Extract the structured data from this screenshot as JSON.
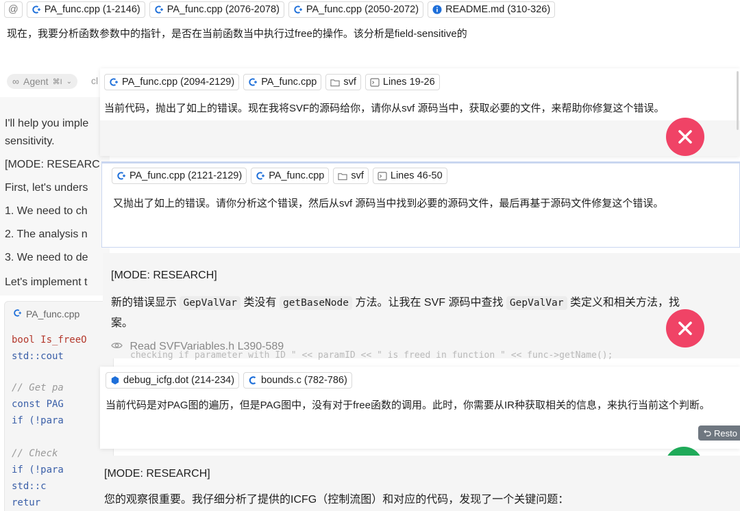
{
  "top_bar": {
    "at_symbol": "@",
    "chips": [
      {
        "label": "PA_func.cpp (1-2146)",
        "icon": "cpp-file-icon"
      },
      {
        "label": "PA_func.cpp (2076-2078)",
        "icon": "cpp-file-icon"
      },
      {
        "label": "PA_func.cpp (2050-2072)",
        "icon": "cpp-file-icon"
      },
      {
        "label": "README.md (310-326)",
        "icon": "info-icon"
      }
    ],
    "prompt": "现在，我要分析函数参数中的指针，是否在当前函数当中执行过free的操作。该分析是field-sensitive的"
  },
  "background": {
    "agent_label": "Agent",
    "agent_shortcut": "⌘I",
    "agent_extra": "cl",
    "lines": [
      "I'll help you imple",
      "sensitivity.",
      "[MODE: RESEARC",
      "First, let's unders",
      "1. We need to ch",
      "2. The analysis n",
      "3. We need to de",
      "Let's implement t"
    ],
    "code_file": "PA_func.cpp",
    "code_lines": [
      {
        "text": "bool Is_freeO",
        "kind": "decl"
      },
      {
        "text": "    std::cout",
        "kind": "plain"
      },
      {
        "text": "    // Get pa",
        "kind": "comment"
      },
      {
        "text": "    const PAG",
        "kind": "keyword"
      },
      {
        "text": "    if (!para",
        "kind": "keyword"
      },
      {
        "text": "    // Check ",
        "kind": "comment"
      },
      {
        "text": "    if (!para",
        "kind": "keyword"
      },
      {
        "text": "        std::c",
        "kind": "plain"
      },
      {
        "text": "        retur",
        "kind": "plain"
      }
    ]
  },
  "card1": {
    "chips": [
      {
        "label": "PA_func.cpp (2094-2129)",
        "icon": "cpp-file-icon"
      },
      {
        "label": "PA_func.cpp",
        "icon": "cpp-file-icon"
      },
      {
        "label": "svf",
        "icon": "folder-icon"
      },
      {
        "label": "Lines 19-26",
        "icon": "terminal-icon"
      }
    ],
    "text": "当前代码，抛出了如上的错误。现在我将SVF的源码给你，请你从svf 源码当中，获取必要的文件，来帮助你修复这个错误。"
  },
  "card2": {
    "chips": [
      {
        "label": "PA_func.cpp (2121-2129)",
        "icon": "cpp-file-icon"
      },
      {
        "label": "PA_func.cpp",
        "icon": "cpp-file-icon"
      },
      {
        "label": "svf",
        "icon": "folder-icon"
      },
      {
        "label": "Lines 46-50",
        "icon": "terminal-icon"
      }
    ],
    "text": "又抛出了如上的错误。请你分析这个错误，然后从svf 源码当中找到必要的源码文件，最后再基于源码文件修复这个错误。"
  },
  "response1": {
    "mode": "[MODE: RESEARCH]",
    "p1": "新的错误显示",
    "c1": "GepValVar",
    "p2": "类没有",
    "c2": "getBaseNode",
    "p3": "方法。让我在 SVF 源码中查找",
    "c3": "GepValVar",
    "p4": "类定义和相关方法，找",
    "line2": "案。",
    "read": "Read SVFVariables.h L390-589",
    "overflow": "checking if parameter with ID \" << paramID << \" is freed in function \" << func->getName();"
  },
  "card3": {
    "chips": [
      {
        "label": "debug_icfg.dot (214-234)",
        "icon": "dot-file-icon"
      },
      {
        "label": "bounds.c (782-786)",
        "icon": "c-file-icon"
      }
    ],
    "text": "当前代码是对PAG图的遍历，但是PAG图中，没有对于free函数的调用。此时，你需要从IR种获取相关的信息，来执行当前这个判断。",
    "restore": "Resto"
  },
  "response2": {
    "mode": "[MODE: RESEARCH]",
    "text": "您的观察很重要。我仔细分析了提供的ICFG（控制流图）和对应的代码，发现了一个关键问题："
  },
  "colors": {
    "error": "#f04366",
    "success": "#1faa59",
    "cpp_icon": "#1e6fd9",
    "keyword": "#3a5fa8",
    "decl": "#b3372b",
    "comment": "#9a9a9a"
  }
}
